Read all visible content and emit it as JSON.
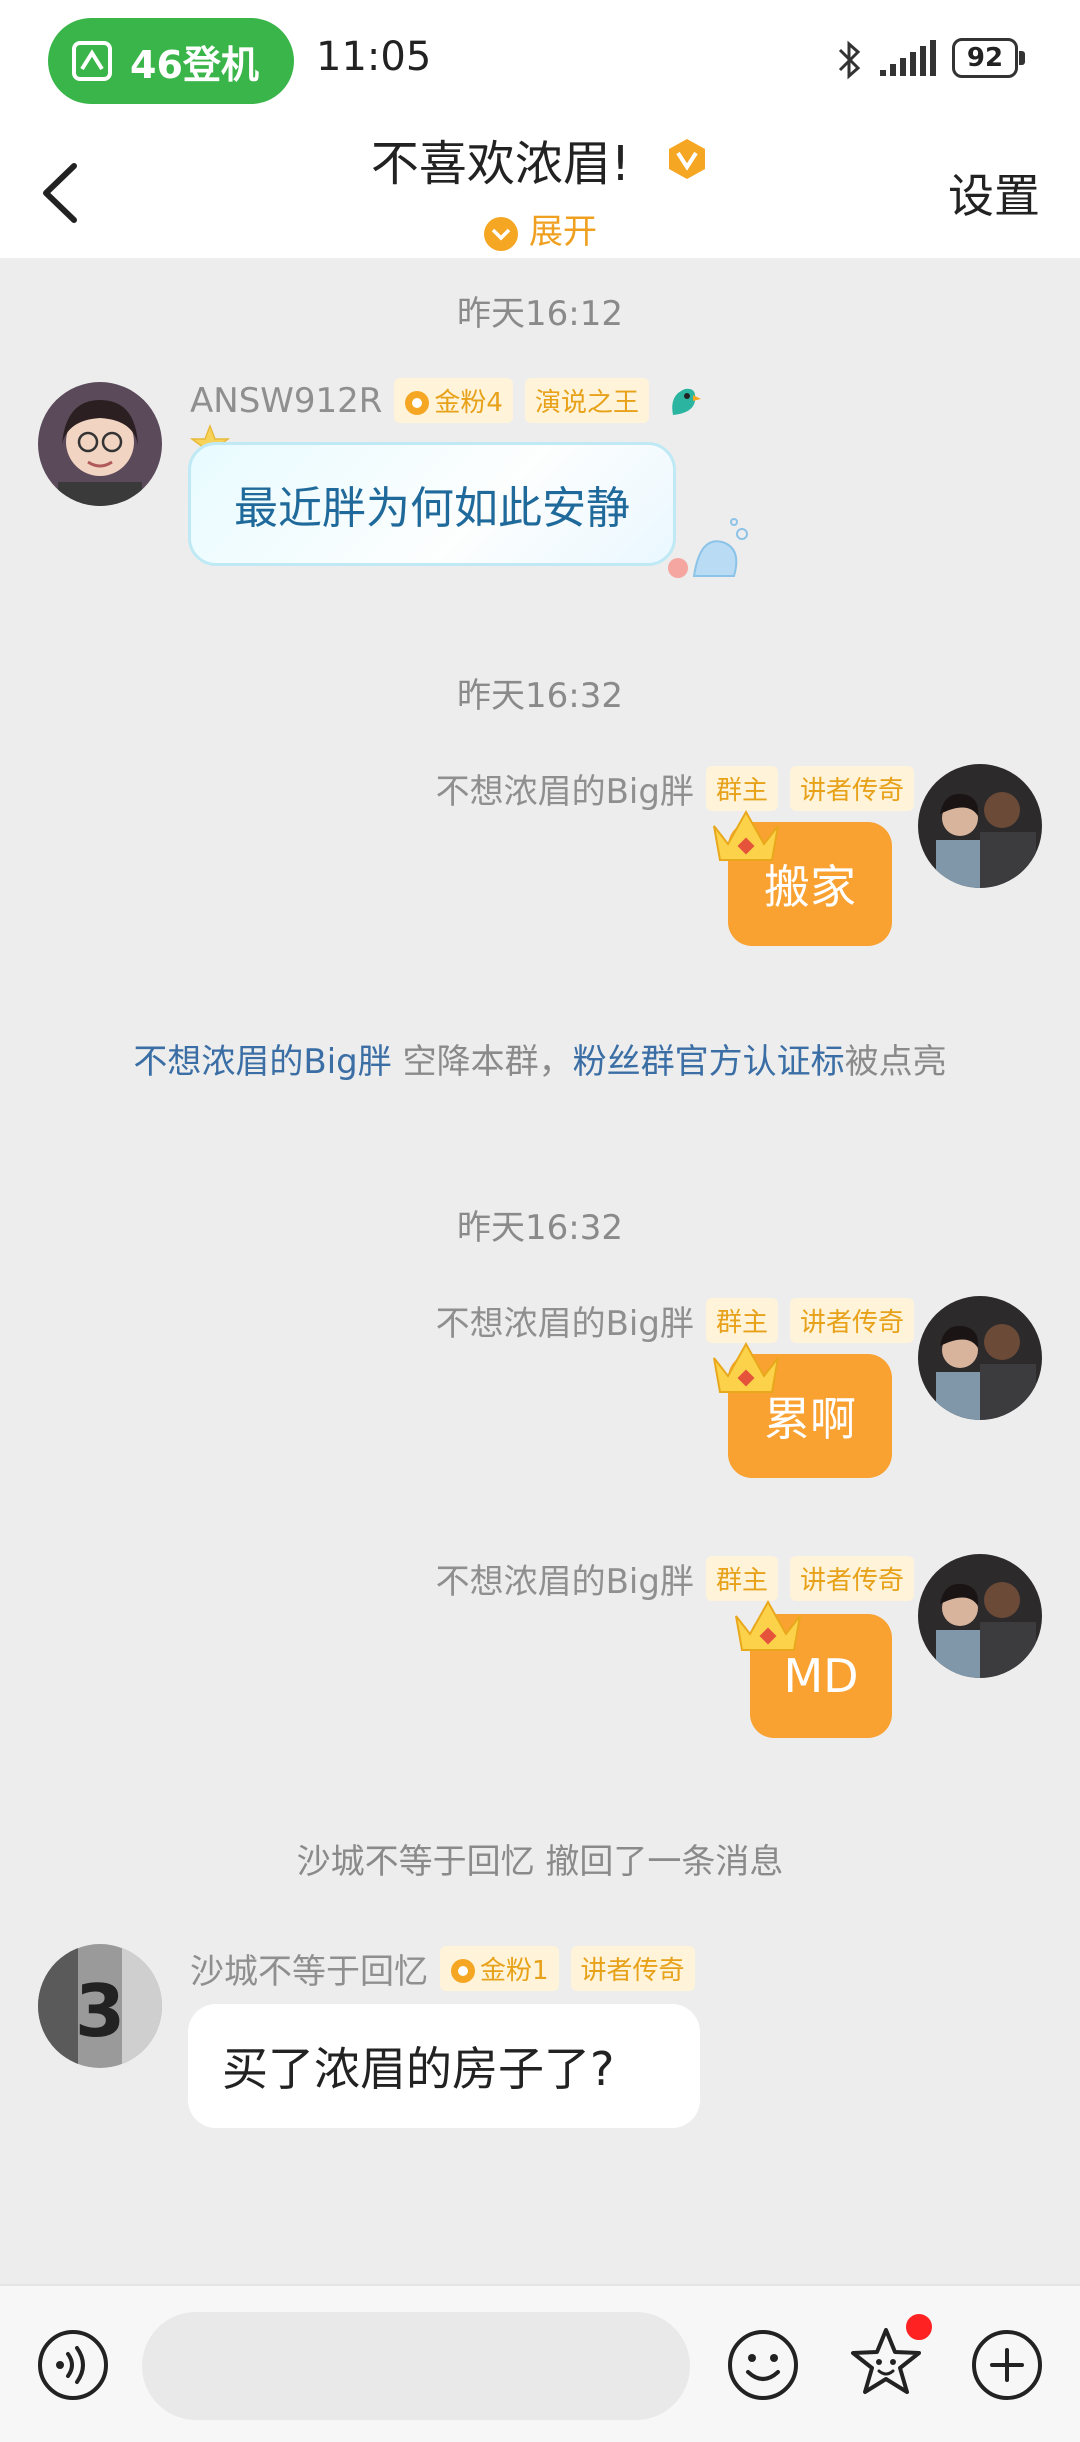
{
  "status_bar": {
    "trip_label": "46登机",
    "time": "11:05",
    "battery": "92",
    "icons": [
      "ticket-icon",
      "bluetooth-icon",
      "signal-icon",
      "battery-icon"
    ]
  },
  "header": {
    "title": "不喜欢浓眉!",
    "expand_label": "展开",
    "settings_label": "设置",
    "back_icon": "chevron-left-icon"
  },
  "messages": [
    {
      "kind": "time",
      "text": "昨天16:12"
    },
    {
      "kind": "msg",
      "side": "left",
      "sender": "ANSW912R",
      "tags": [
        "金粉4",
        "演说之王"
      ],
      "text": "最近胖为何如此安静"
    },
    {
      "kind": "time",
      "text": "昨天16:32"
    },
    {
      "kind": "msg",
      "side": "right",
      "sender": "不想浓眉的Big胖",
      "tags": [
        "群主",
        "讲者传奇"
      ],
      "text": "搬家"
    },
    {
      "kind": "system",
      "link1": "不想浓眉的Big胖",
      "mid": " 空降本群，",
      "link2": "粉丝群官方认证标",
      "tail": "被点亮"
    },
    {
      "kind": "time",
      "text": "昨天16:32"
    },
    {
      "kind": "msg",
      "side": "right",
      "sender": "不想浓眉的Big胖",
      "tags": [
        "群主",
        "讲者传奇"
      ],
      "text": "累啊"
    },
    {
      "kind": "msg",
      "side": "right",
      "sender": "不想浓眉的Big胖",
      "tags": [
        "群主",
        "讲者传奇"
      ],
      "text": "MD"
    },
    {
      "kind": "recall",
      "text": "沙城不等于回忆 撤回了一条消息"
    },
    {
      "kind": "msg",
      "side": "left",
      "sender": "沙城不等于回忆",
      "tags": [
        "金粉1",
        "讲者传奇"
      ],
      "text": "买了浓眉的房子了?"
    }
  ],
  "colors": {
    "accent_orange": "#f9a131",
    "trip_green": "#39b54a",
    "link_blue": "#3a6ea5"
  }
}
